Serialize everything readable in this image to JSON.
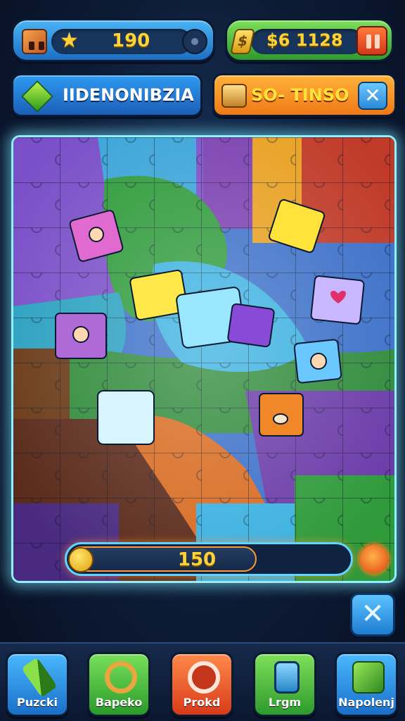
{
  "hud": {
    "stars": "190",
    "coins": "$6  1128"
  },
  "banners": {
    "level_name": "IIDENONIBZIA",
    "mode_name": "SO- TINSO",
    "close_symbol": "✕"
  },
  "board": {
    "progress_value": "150",
    "progress_fraction": 0.67
  },
  "tools_symbol": "✕",
  "bottom_nav": [
    {
      "label": "Puzcki",
      "icon": "pencil-icon"
    },
    {
      "label": "Bapeko",
      "icon": "ring-icon"
    },
    {
      "label": "Prokd",
      "icon": "refresh-icon"
    },
    {
      "label": "Lrgm",
      "icon": "tablet-icon"
    },
    {
      "label": "Napolenj",
      "icon": "gift-box-icon"
    }
  ],
  "colors": {
    "accent_blue": "#2e9af1",
    "accent_green": "#4fbf3a",
    "accent_orange": "#f07816",
    "gold_text": "#ffd23a",
    "board_glow": "#8ff0ff"
  }
}
